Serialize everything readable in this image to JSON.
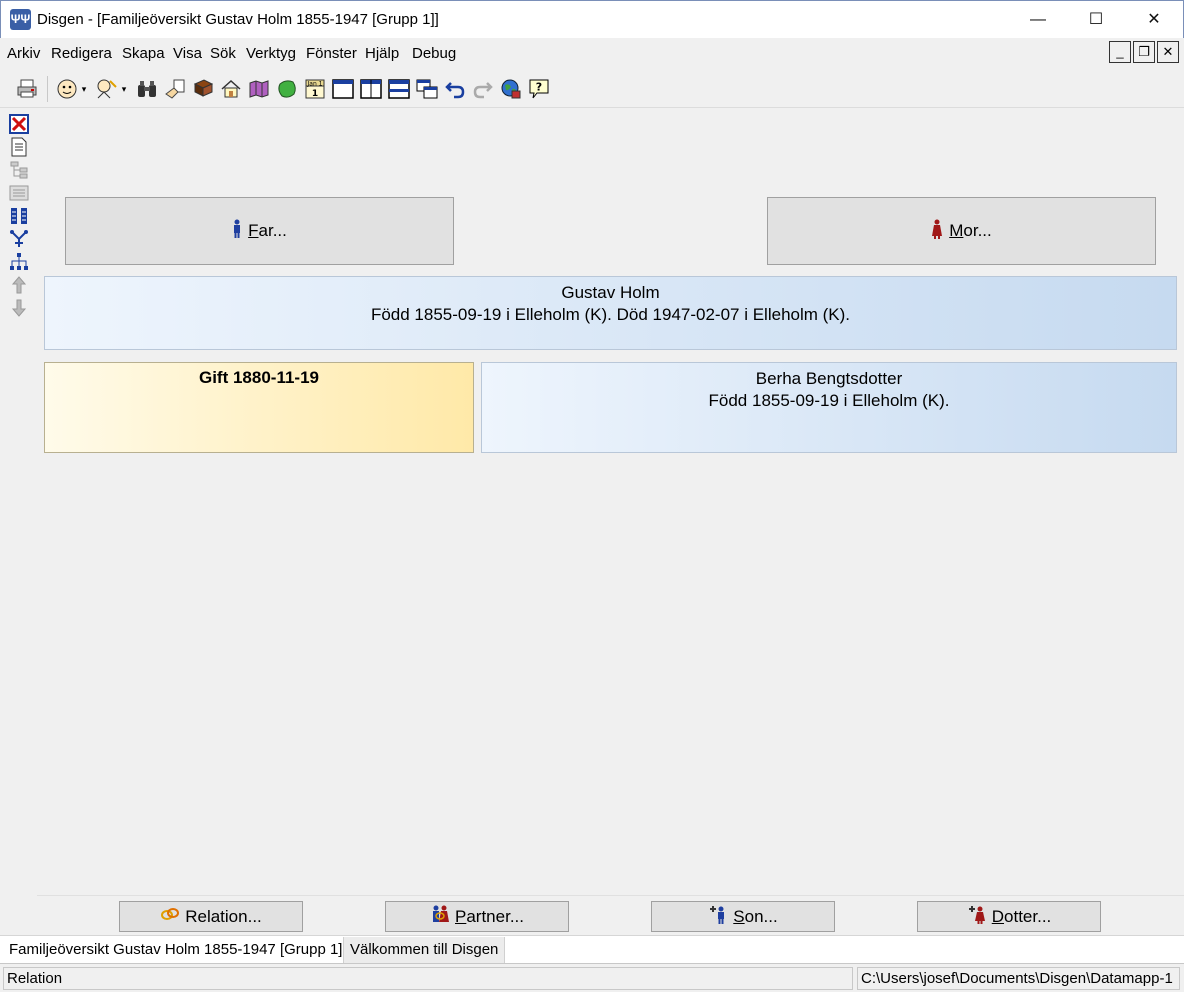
{
  "window": {
    "title": "Disgen - [Familjeöversikt Gustav Holm 1855-1947 [Grupp 1]]",
    "minimize": "—",
    "maximize": "☐",
    "close": "✕"
  },
  "menu": {
    "items": [
      "Arkiv",
      "Redigera",
      "Skapa",
      "Visa",
      "Sök",
      "Verktyg",
      "Fönster",
      "Hjälp",
      "Debug"
    ],
    "mdi_minimize": "_",
    "mdi_restore": "❐",
    "mdi_close": "✕"
  },
  "toolbar": {
    "icons": [
      "print-icon",
      "person-face-icon",
      "person-search-icon",
      "binoculars-icon",
      "hand-note-icon",
      "book-icon",
      "home-icon",
      "map-icon",
      "globe-green-icon",
      "calendar-icon",
      "single-window-icon",
      "split-vertical-icon",
      "split-horizontal-icon",
      "cascade-icon",
      "undo-icon",
      "redo-icon",
      "world-icon",
      "help-icon"
    ],
    "calendar_text": "Jan 1"
  },
  "lefttools": {
    "icons": [
      "close-red-icon",
      "document-icon",
      "tree-icon",
      "pedigree-icon",
      "columns-icon",
      "descendants-icon",
      "hierarchy-icon",
      "ancestor-up-icon",
      "ancestor-down-icon"
    ]
  },
  "family": {
    "father_button": "Far...",
    "mother_button": "Mor...",
    "person_name": "Gustav Holm",
    "person_details": "Född 1855-09-19 i Elleholm (K). Död 1947-02-07 i Elleholm (K).",
    "marriage_label": "Gift 1880-11-19",
    "partner_name": "Berha Bengtsdotter",
    "partner_details": "Född 1855-09-19 i Elleholm (K)."
  },
  "actions": {
    "relation": "Relation...",
    "partner": "Partner...",
    "son": "Son...",
    "daughter": "Dotter..."
  },
  "tabs": [
    "Familjeöversikt Gustav Holm 1855-1947 [Grupp 1]",
    "Välkommen till Disgen"
  ],
  "status": {
    "left": "Relation",
    "right": "C:\\Users\\josef\\Documents\\Disgen\\Datamapp-1"
  },
  "colors": {
    "person_gradient_start": "#eef5fd",
    "person_gradient_end": "#c6daf0",
    "marriage_gradient_start": "#fffbea",
    "marriage_gradient_end": "#ffe9a8",
    "male": "#1f3fa0",
    "female": "#a01818"
  }
}
